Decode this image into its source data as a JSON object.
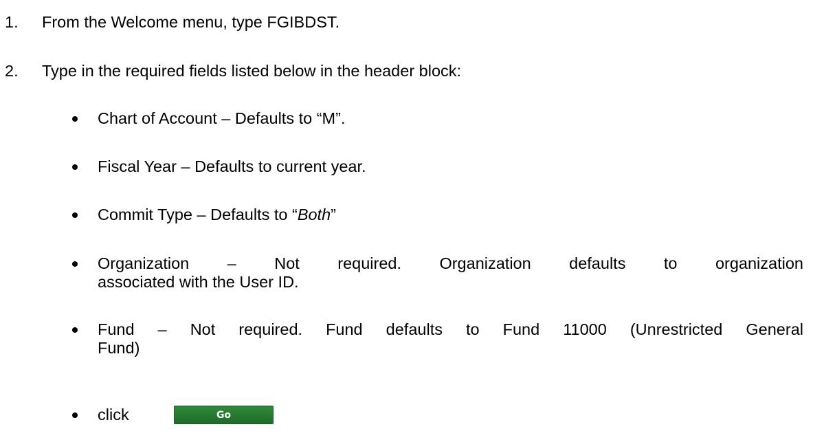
{
  "steps": [
    {
      "number": "1.",
      "text": "From the Welcome menu, type FGIBDST."
    },
    {
      "number": "2.",
      "text": "Type in the required fields listed below in the header block:"
    }
  ],
  "bullets": {
    "chart": "Chart of Account – Defaults to “M”.",
    "fiscal": "Fiscal Year – Defaults to current year.",
    "commit_prefix": "Commit Type – Defaults to “",
    "commit_value": "Both",
    "commit_suffix": "”",
    "org_line1": "Organization – Not required.  Organization defaults to organization",
    "org_line2": "associated with the User ID.",
    "fund_line1": "Fund – Not required.  Fund defaults to Fund 11000 (Unrestricted General",
    "fund_line2": "Fund)",
    "click": "click"
  },
  "go_button": {
    "label": "Go",
    "color": "#267a31"
  }
}
